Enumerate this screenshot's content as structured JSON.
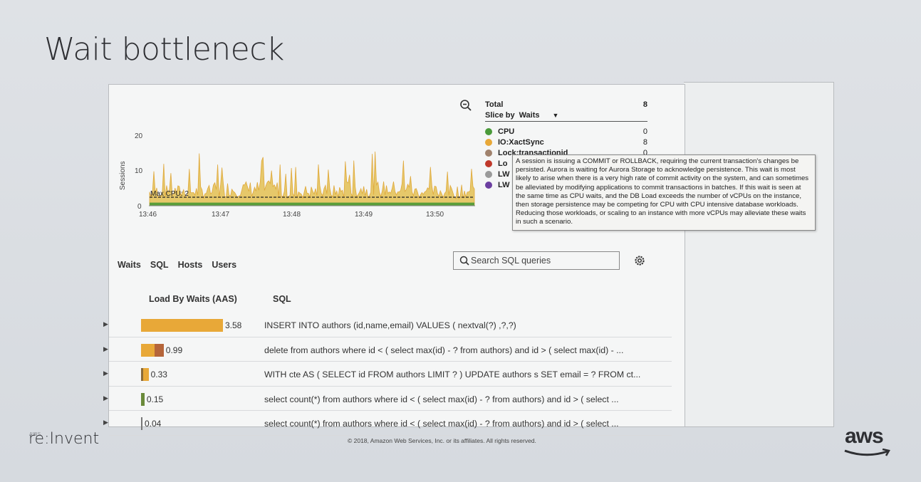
{
  "slide": {
    "title": "Wait bottleneck",
    "brand": "re:Invent",
    "brand_small": "AWS",
    "copyright": "© 2018, Amazon Web Services, Inc. or its affiliates. All rights reserved.",
    "aws_logo": "aws"
  },
  "chart": {
    "ylabel": "Sessions",
    "y_ticks": [
      "20",
      "10",
      "0"
    ],
    "x_ticks": [
      "13:46",
      "13:47",
      "13:48",
      "13:49",
      "13:50"
    ],
    "max_cpu_label": "Max CPU: 2"
  },
  "chart_data": {
    "type": "area",
    "ylabel": "Sessions",
    "ylim": [
      0,
      20
    ],
    "x": [
      "13:46",
      "13:47",
      "13:48",
      "13:49",
      "13:50"
    ],
    "threshold": {
      "label": "Max CPU: 2",
      "value": 2
    },
    "series": [
      {
        "name": "CPU",
        "color": "#5a9e3a",
        "values": [
          0.3,
          0.3,
          0.3,
          0.3,
          0.3
        ]
      },
      {
        "name": "IO:XactSync",
        "color": "#e0a93c",
        "values": [
          5,
          6,
          5,
          6,
          5
        ]
      }
    ]
  },
  "legend": {
    "total_label": "Total",
    "total_value": "8",
    "slice_by_label": "Slice by",
    "slice_by_value": "Waits",
    "items": [
      {
        "label": "CPU",
        "value": "0",
        "color": "#4a9a3a"
      },
      {
        "label": "IO:XactSync",
        "value": "8",
        "color": "#e8a838"
      },
      {
        "label": "Lock:transactionid",
        "value": "0",
        "color": "#a0826d"
      },
      {
        "label": "Lo",
        "value": "",
        "color": "#c0392b"
      },
      {
        "label": "LW",
        "value": "",
        "color": "#9a9a9a"
      },
      {
        "label": "LW",
        "value": "",
        "color": "#6b3fa0"
      }
    ]
  },
  "tooltip": {
    "text": "A session is issuing a COMMIT or ROLLBACK, requiring the current transaction's changes be persisted. Aurora is waiting for Aurora Storage to acknowledge persistence. This wait is most likely to arise when there is a very high rate of commit activity on the system, and can sometimes be alleviated by modifying applications to commit transactions in batches. If this wait is seen at the same time as CPU waits, and the DB Load exceeds the number of vCPUs on the instance, then storage persistence may be competing for CPU with CPU intensive database workloads. Reducing those workloads, or scaling to an instance with more vCPUs may alleviate these waits in such a scenario."
  },
  "tabs": [
    "Waits",
    "SQL",
    "Hosts",
    "Users"
  ],
  "search": {
    "placeholder": "Search SQL queries"
  },
  "table": {
    "col_load": "Load By Waits (AAS)",
    "col_sql": "SQL",
    "rows": [
      {
        "value": 3.58,
        "label": "3.58",
        "sql": "INSERT INTO authors (id,name,email) VALUES ( nextval(?) ,?,?)",
        "segments": [
          {
            "color": "#e8a838",
            "frac": 1.0
          }
        ]
      },
      {
        "value": 0.99,
        "label": "0.99",
        "sql": "delete from authors where id < ( select max(id) - ? from authors) and id > ( select max(id) - ...",
        "segments": [
          {
            "color": "#e8a838",
            "frac": 0.6
          },
          {
            "color": "#b5653a",
            "frac": 0.4
          }
        ]
      },
      {
        "value": 0.33,
        "label": "0.33",
        "sql": "WITH cte AS ( SELECT id FROM authors LIMIT ? ) UPDATE authors s SET email = ? FROM ct...",
        "segments": [
          {
            "color": "#8a6a3a",
            "frac": 0.3
          },
          {
            "color": "#e8a838",
            "frac": 0.7
          }
        ]
      },
      {
        "value": 0.15,
        "label": "0.15",
        "sql": "select count(*) from authors where id < ( select max(id) - ? from authors) and id > ( select ...",
        "segments": [
          {
            "color": "#6a8a3a",
            "frac": 1.0
          }
        ]
      },
      {
        "value": 0.04,
        "label": "0.04",
        "sql": "select count(*) from authors where id < ( select max(id) - ? from authors) and id > ( select ...",
        "segments": [
          {
            "color": "#777777",
            "frac": 1.0
          }
        ]
      }
    ]
  }
}
